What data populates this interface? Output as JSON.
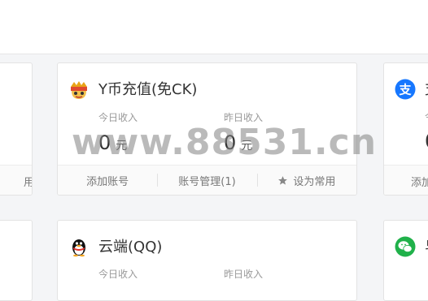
{
  "cards": {
    "ycoin": {
      "title": "Y币充值(免CK)",
      "icon": "mask-icon",
      "today_label": "今日收入",
      "today_value": "0",
      "yesterday_label": "昨日收入",
      "yesterday_value": "0",
      "unit": "元",
      "actions": {
        "add": "添加账号",
        "manage": "账号管理(1)",
        "favorite": "设为常用"
      }
    },
    "cloud": {
      "title": "云端(QQ)",
      "icon": "qq-penguin-icon",
      "today_label": "今日收入",
      "yesterday_label": "昨日收入"
    },
    "right_top": {
      "icon": "alipay-icon",
      "title_partial": "支",
      "label_partial": "今",
      "value_partial": "0",
      "action_partial": "添加"
    },
    "right_bottom": {
      "icon": "wechat-icon",
      "title_partial": "皂"
    },
    "left_top": {
      "action_partial": "用"
    }
  },
  "watermark": "www.88531.cn",
  "colors": {
    "page_bg": "#f4f5f7",
    "card_bg": "#ffffff",
    "border": "#e3e3e3",
    "muted_text": "#999999",
    "alipay_blue": "#1677ff",
    "wechat_green": "#20b14a"
  }
}
